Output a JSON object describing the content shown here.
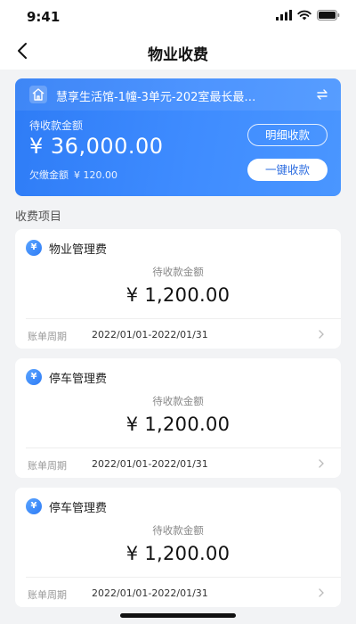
{
  "status_bar": {
    "time": "9:41"
  },
  "header": {
    "title": "物业收费"
  },
  "summary": {
    "room_name": "慧享生活馆-1幢-3单元-202室最长最…",
    "pending_label": "待收款金额",
    "pending_amount": "¥ 36,000.00",
    "arrears_label": "欠缴金额",
    "arrears_amount": "¥ 120.00",
    "detail_button": "明细收款",
    "collect_button": "一键收款"
  },
  "section_title": "收费项目",
  "fees": [
    {
      "name": "物业管理费",
      "label": "待收款金额",
      "amount": "¥ 1,200.00",
      "period_label": "账单周期",
      "period": "2022/01/01-2022/01/31"
    },
    {
      "name": "停车管理费",
      "label": "待收款金额",
      "amount": "¥ 1,200.00",
      "period_label": "账单周期",
      "period": "2022/01/01-2022/01/31"
    },
    {
      "name": "停车管理费",
      "label": "待收款金额",
      "amount": "¥ 1,200.00",
      "period_label": "账单周期",
      "period": "2022/01/01-2022/01/31"
    }
  ],
  "icons": {
    "fee_icon_glyph": "¥",
    "house_icon": "house-icon",
    "switch_icon": "switch-icon",
    "back_icon": "chevron-left-icon"
  },
  "colors": {
    "accent": "#2e7cf6",
    "background": "#f2f3f5"
  }
}
